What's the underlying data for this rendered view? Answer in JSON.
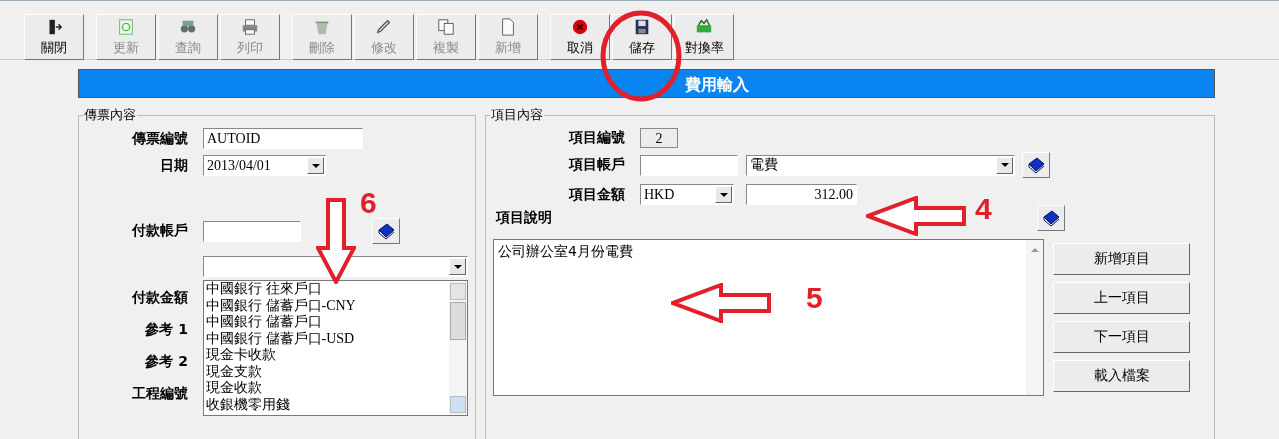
{
  "toolbar": [
    {
      "label": "關閉",
      "disabled": false
    },
    {
      "label": "更新",
      "disabled": true
    },
    {
      "label": "查詢",
      "disabled": true
    },
    {
      "label": "列印",
      "disabled": true
    },
    {
      "label": "刪除",
      "disabled": true
    },
    {
      "label": "修改",
      "disabled": true
    },
    {
      "label": "複製",
      "disabled": true
    },
    {
      "label": "新增",
      "disabled": true
    },
    {
      "label": "取消",
      "disabled": false
    },
    {
      "label": "儲存",
      "disabled": false
    },
    {
      "label": "對換率",
      "disabled": false
    }
  ],
  "banner": {
    "title": "費用輸入"
  },
  "voucher": {
    "title": "傳票內容",
    "voucher_no": {
      "label": "傳票編號",
      "value": "AUTOID"
    },
    "date": {
      "label": "日期",
      "value": "2013/04/01"
    },
    "payment_account": {
      "label": "付款帳戶"
    },
    "payment_amount": {
      "label": "付款金額"
    },
    "ref_1": {
      "label": "參考 1"
    },
    "ref_2": {
      "label": "參考 2"
    },
    "project_no": {
      "label": "工程編號"
    },
    "account_list": [
      "中國銀行 往來戶口",
      "中國銀行 儲蓄戶口-CNY",
      "中國銀行 儲蓄戶口",
      "中國銀行 儲蓄戶口-USD",
      "現金卡收款",
      "現金支款",
      "現金收款",
      "收銀機零用錢"
    ]
  },
  "item": {
    "title": "項目內容",
    "item_no": {
      "label": "項目編號",
      "value": "2"
    },
    "item_account": {
      "label": "項目帳戶",
      "name": "電費"
    },
    "item_amount": {
      "label": "項目金額",
      "currency": "HKD",
      "value": "312.00"
    },
    "description": {
      "label": "項目說明",
      "value": "公司辦公室4月份電費"
    },
    "buttons": [
      "新增項目",
      "上一項目",
      "下一項目",
      "載入檔案"
    ]
  },
  "annotations": [
    {
      "kind": "circle"
    },
    {
      "kind": "down-arrow",
      "number": "6"
    },
    {
      "kind": "left-arrow",
      "number": "4"
    },
    {
      "kind": "left-arrow",
      "number": "5"
    }
  ]
}
